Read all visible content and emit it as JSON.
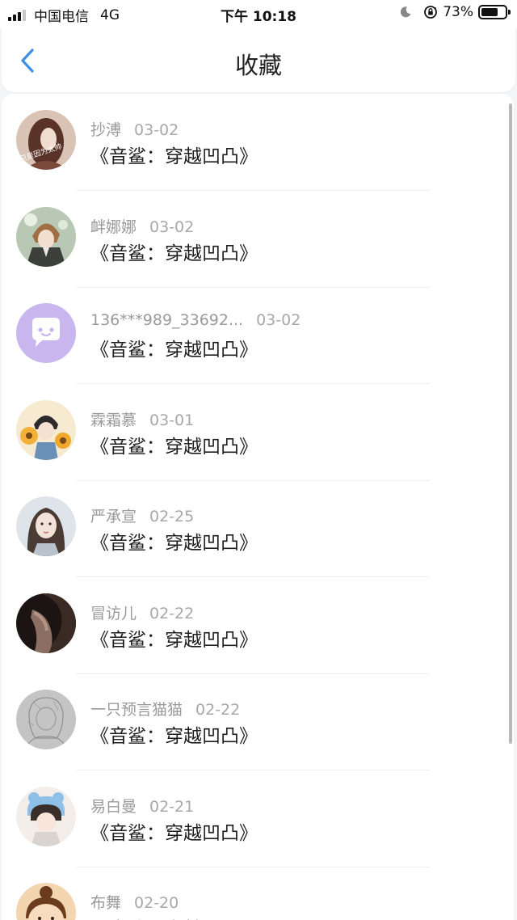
{
  "status_bar": {
    "carrier": "中国电信",
    "network": "4G",
    "time": "下午 10:18",
    "battery": "73%",
    "battery_level": 0.73
  },
  "nav": {
    "title": "收藏",
    "back_icon": "chevron-left-icon",
    "accent_color": "#3d8fe8"
  },
  "favorites": [
    {
      "user": "抄溥",
      "date": "03-02",
      "title": "《音鲨：穿越凹凸》",
      "avatar_text": "只是因为太帅"
    },
    {
      "user": "衅娜娜",
      "date": "03-02",
      "title": "《音鲨：穿越凹凸》"
    },
    {
      "user": "136***989_33692...",
      "date": "03-02",
      "title": "《音鲨：穿越凹凸》"
    },
    {
      "user": "霖霜慕",
      "date": "03-01",
      "title": "《音鲨：穿越凹凸》"
    },
    {
      "user": "严承宣",
      "date": "02-25",
      "title": "《音鲨：穿越凹凸》"
    },
    {
      "user": "冒访儿",
      "date": "02-22",
      "title": "《音鲨：穿越凹凸》"
    },
    {
      "user": "一只预言猫猫",
      "date": "02-22",
      "title": "《音鲨：穿越凹凸》"
    },
    {
      "user": "易白曼",
      "date": "02-21",
      "title": "《音鲨：穿越凹凸》"
    },
    {
      "user": "布舞",
      "date": "02-20",
      "title": "《音鲨：穿越凹凸》"
    }
  ]
}
